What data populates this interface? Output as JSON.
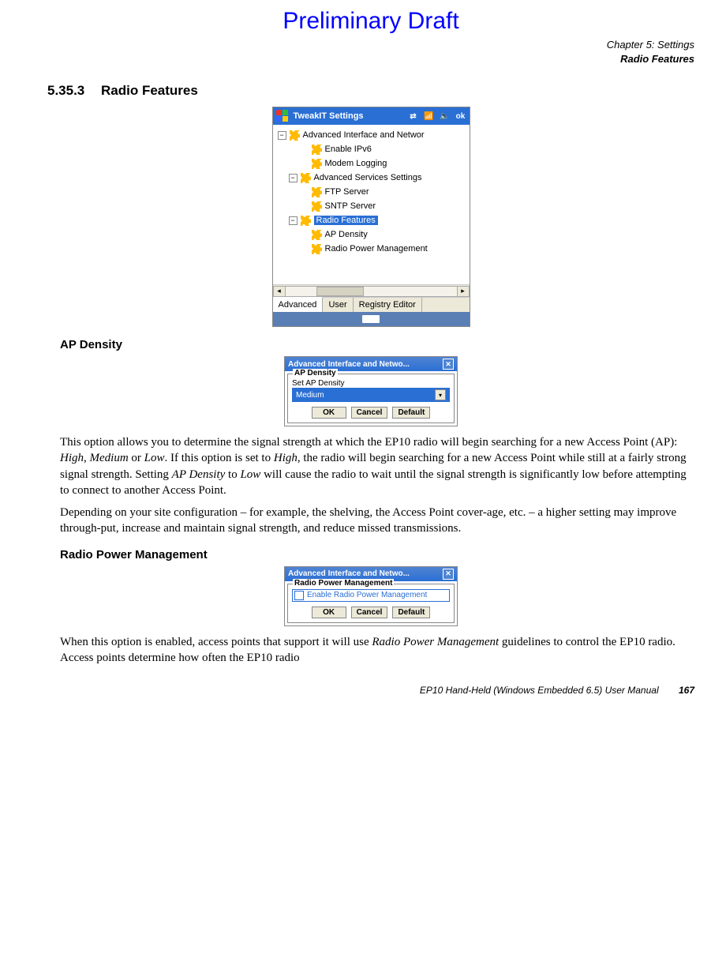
{
  "watermark": "Preliminary Draft",
  "chapter": {
    "line1": "Chapter 5:  Settings",
    "line2": "Radio Features"
  },
  "section": {
    "number": "5.35.3",
    "title": "Radio Features"
  },
  "fig1": {
    "title": "TweakIT Settings",
    "ok": "ok",
    "items": [
      "Advanced Interface and Networ",
      "Enable IPv6",
      "Modem Logging",
      "Advanced Services Settings",
      "FTP Server",
      "SNTP Server",
      "Radio Features",
      "AP Density",
      "Radio Power Management"
    ],
    "tabs": {
      "t1": "Advanced",
      "t2": "User",
      "t3": "Registry Editor"
    }
  },
  "sub1": "AP Density",
  "fig2": {
    "title": "Advanced Interface and Netwo...",
    "group": "AP Density",
    "label": "Set AP Density",
    "value": "Medium",
    "ok": "OK",
    "cancel": "Cancel",
    "def": "Default"
  },
  "p1a": "This option allows you to determine the signal strength at which the EP10 radio will begin searching for a new Access Point (AP): ",
  "p1b": ". If this option is set to ",
  "p1c": ", the radio will begin searching for a new Access Point while still at a fairly strong signal strength. Setting ",
  "p1d": " to ",
  "p1e": " will cause the radio to wait until the signal strength is significantly low before attempting to connect to another Access Point.",
  "em": {
    "high": "High",
    "medium": "Medium",
    "low": "Low",
    "apd": "AP Density",
    "rpm": "Radio Power Management"
  },
  "conj": {
    "comma": ", ",
    "or": " or "
  },
  "p2": "Depending on your site configuration – for example, the shelving, the Access Point cover-age, etc. – a higher setting may improve through-put, increase and maintain signal strength, and reduce missed transmissions.",
  "sub2": "Radio Power Management",
  "fig3": {
    "title": "Advanced Interface and Netwo...",
    "group": "Radio Power Management",
    "check": "Enable Radio Power Management",
    "ok": "OK",
    "cancel": "Cancel",
    "def": "Default"
  },
  "p3a": "When this option is enabled, access points that support it will use ",
  "p3b": " guidelines to control the EP10 radio. Access points determine how often the EP10 radio",
  "footer": {
    "text": "EP10 Hand-Held (Windows Embedded 6.5) User Manual",
    "page": "167"
  }
}
